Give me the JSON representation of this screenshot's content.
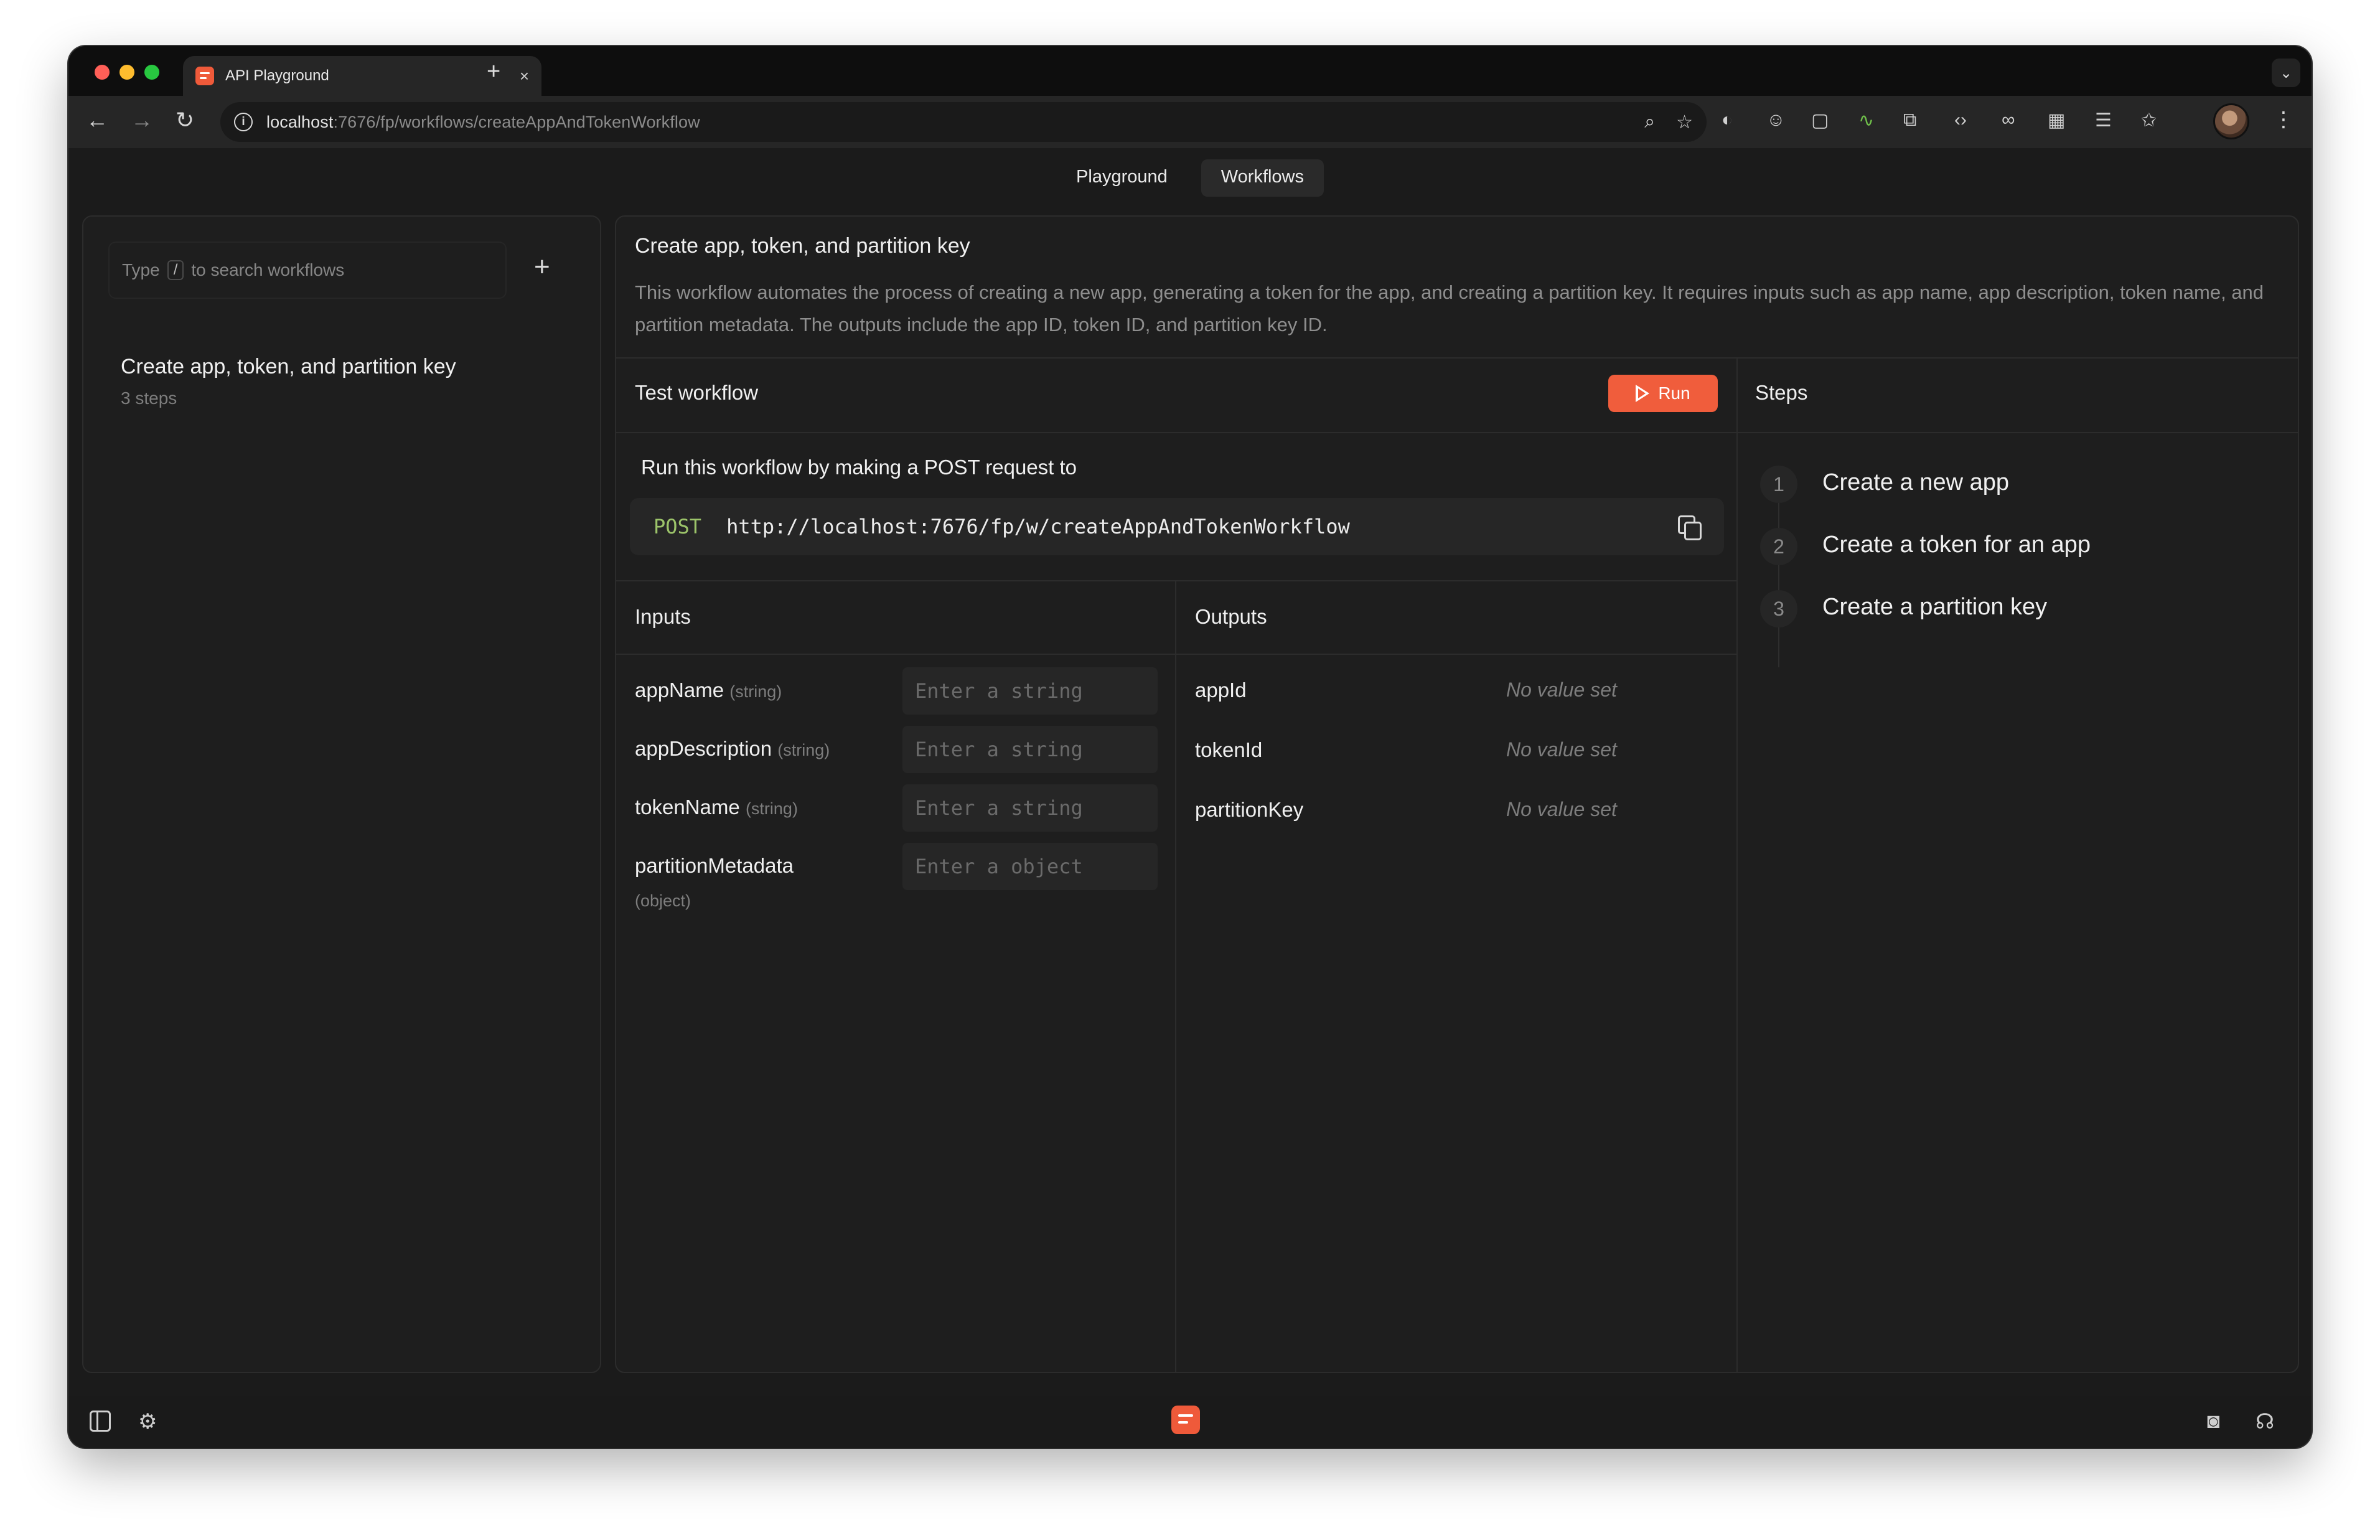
{
  "browser": {
    "tab_title": "API Playground",
    "tab_close": "×",
    "new_tab": "+",
    "tab_menu": "⌄",
    "url_host": "localhost",
    "url_path": ":7676/fp/workflows/createAppAndTokenWorkflow",
    "icons": [
      "zoom-icon",
      "bookmark-star-icon",
      "extension-icons",
      "profile-avatar"
    ]
  },
  "nav": {
    "tabs": [
      {
        "label": "Playground",
        "active": false
      },
      {
        "label": "Workflows",
        "active": true
      }
    ]
  },
  "sidebar": {
    "search_prefix": "Type",
    "search_key": "/",
    "search_suffix": "to search workflows",
    "add": "+",
    "workflows": [
      {
        "title": "Create app, token, and partition key",
        "subtitle": "3 steps"
      }
    ]
  },
  "workflow": {
    "title": "Create app, token, and partition key",
    "description": "This workflow automates the process of creating a new app, generating a token for the app, and creating a partition key. It requires inputs such as app name, app description, token name, and partition metadata. The outputs include the app ID, token ID, and partition key ID.",
    "test_title": "Test workflow",
    "run_label": "Run",
    "post_label": "Run this workflow by making a POST request to",
    "method": "POST",
    "endpoint": "http://localhost:7676/fp/w/createAppAndTokenWorkflow",
    "inputs_title": "Inputs",
    "outputs_title": "Outputs",
    "steps_title": "Steps",
    "inputs": [
      {
        "name": "appName",
        "type": "(string)",
        "placeholder": "Enter a string"
      },
      {
        "name": "appDescription",
        "type": "(string)",
        "placeholder": "Enter a string"
      },
      {
        "name": "tokenName",
        "type": "(string)",
        "placeholder": "Enter a string"
      },
      {
        "name": "partitionMetadata",
        "type": "(object)",
        "placeholder": "Enter a object"
      }
    ],
    "outputs": [
      {
        "name": "appId",
        "value": "No value set"
      },
      {
        "name": "tokenId",
        "value": "No value set"
      },
      {
        "name": "partitionKey",
        "value": "No value set"
      }
    ],
    "steps": [
      {
        "num": "1",
        "label": "Create a new app"
      },
      {
        "num": "2",
        "label": "Create a token for an app"
      },
      {
        "num": "3",
        "label": "Create a partition key"
      }
    ]
  },
  "colors": {
    "accent": "#f05d3c",
    "method": "#9cc46a",
    "background": "#1b1b1b"
  }
}
